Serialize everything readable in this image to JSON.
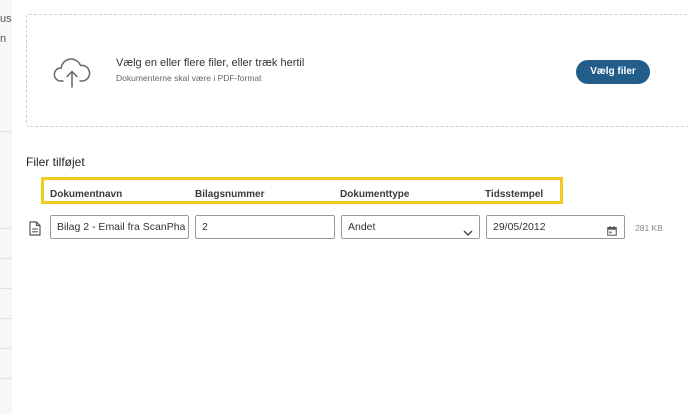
{
  "background": {
    "text1": "us:",
    "text2": "n"
  },
  "upload": {
    "title": "Vælg en eller flere filer, eller træk hertil",
    "subtitle": "Dokumenterne skal være i PDF-format",
    "button_label": "Vælg filer",
    "icon": "cloud-upload-icon"
  },
  "files": {
    "section_title": "Filer tilføjet",
    "columns": [
      "Dokumentnavn",
      "Bilagsnummer",
      "Dokumenttype",
      "Tidsstempel"
    ],
    "rows": [
      {
        "icon": "document-icon",
        "name": "Bilag 2 - Email fra ScanPha",
        "number": "2",
        "type": "Andet",
        "timestamp": "29/05/2012",
        "size": "281 KB"
      }
    ]
  },
  "colors": {
    "primary": "#235e8b",
    "highlight": "#f2cb1d"
  }
}
